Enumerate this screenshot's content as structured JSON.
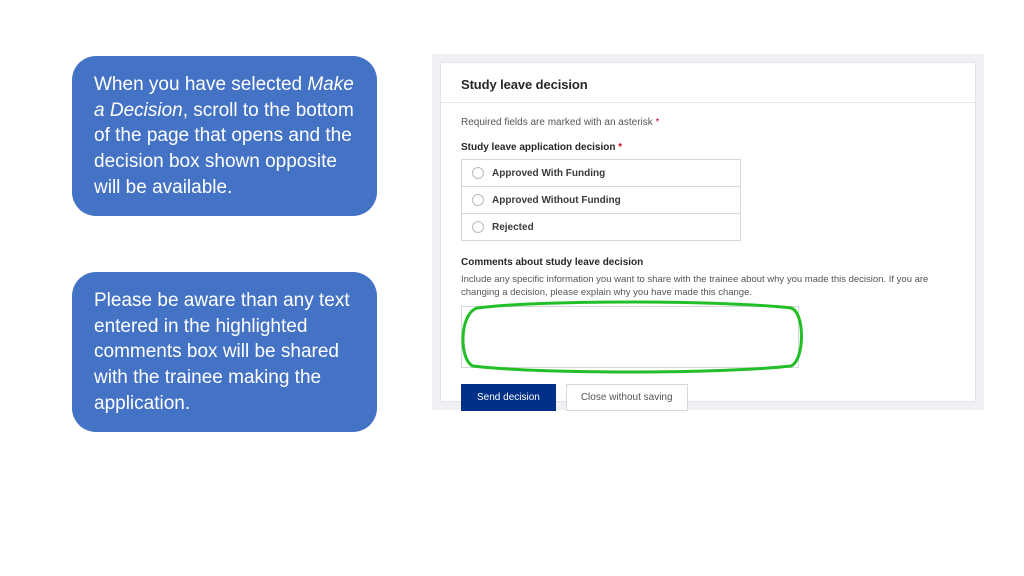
{
  "callouts": {
    "first_pre": "When you have selected ",
    "first_italic": "Make a Decision",
    "first_post": ", scroll to the bottom of the page that opens and the decision box shown opposite will be available.",
    "second": "Please be aware than any text entered in the highlighted comments box will be shared with the trainee making the application."
  },
  "panel": {
    "title": "Study leave decision",
    "required_text": "Required fields are marked with an asterisk ",
    "asterisk": "*",
    "decision_label": "Study leave application decision ",
    "options": [
      "Approved With Funding",
      "Approved Without Funding",
      "Rejected"
    ],
    "comments_label": "Comments about study leave decision",
    "comments_help": "Include any specific information you want to share with the trainee about why you made this decision. If you are changing a decision, please explain why you have made this change.",
    "send": "Send decision",
    "close": "Close without saving"
  }
}
